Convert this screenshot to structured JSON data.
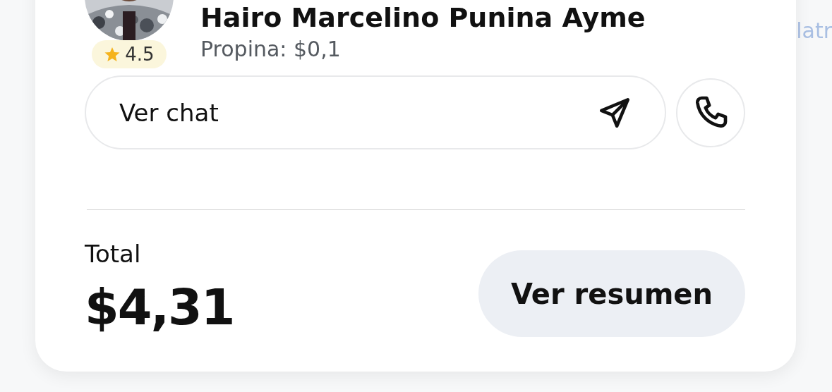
{
  "background_text": "latr",
  "driver": {
    "name": "Hairo Marcelino Punina Ayme",
    "tip": "Propina: $0,1",
    "rating": "4.5"
  },
  "chat": {
    "label": "Ver chat"
  },
  "total": {
    "label": "Total",
    "amount": "$4,31"
  },
  "buttons": [
    {
      "label": "Ver resumen"
    }
  ]
}
